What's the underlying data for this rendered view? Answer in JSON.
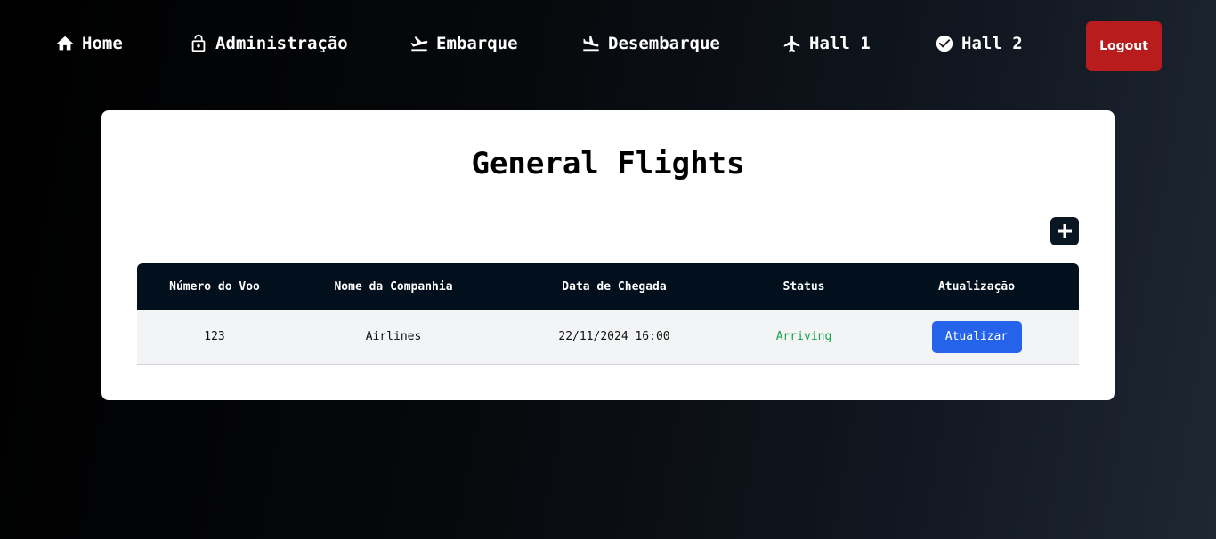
{
  "nav": {
    "items": [
      {
        "label": "Home",
        "icon": "home-icon"
      },
      {
        "label": "Administração",
        "icon": "lock-icon"
      },
      {
        "label": "Embarque",
        "icon": "flight-takeoff-icon"
      },
      {
        "label": "Desembarque",
        "icon": "flight-land-icon"
      },
      {
        "label": "Hall 1",
        "icon": "airplane-icon"
      },
      {
        "label": "Hall 2",
        "icon": "check-circle-icon"
      }
    ],
    "logout_label": "Logout"
  },
  "main": {
    "title": "General Flights",
    "add_icon": "plus-icon"
  },
  "table": {
    "headers": [
      "Número do Voo",
      "Nome da Companhia",
      "Data de Chegada",
      "Status",
      "Atualização"
    ],
    "rows": [
      {
        "flight_number": "123",
        "company": "Airlines",
        "arrival": "22/11/2024 16:00",
        "status": "Arriving",
        "action_label": "Atualizar"
      }
    ]
  },
  "colors": {
    "logout": "#b91c1c",
    "update_button": "#2563eb",
    "status_arriving": "#16a34a",
    "table_header": "#020f1d"
  }
}
